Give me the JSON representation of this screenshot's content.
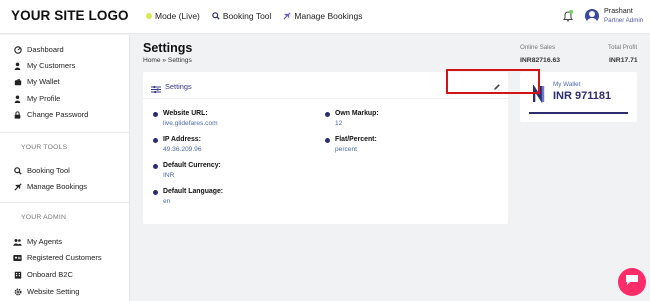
{
  "brand": {
    "logo_text": "YOUR SITE LOGO"
  },
  "topnav": {
    "mode_label": "Mode (Live)",
    "booking_tool_label": "Booking Tool",
    "manage_bookings_label": "Manage Bookings"
  },
  "user": {
    "name": "Prashant",
    "role": "Partner Admin"
  },
  "sidebar": {
    "main_items": [
      {
        "label": "Dashboard",
        "icon": "dashboard-icon"
      },
      {
        "label": "My Customers",
        "icon": "user-icon"
      },
      {
        "label": "My Wallet",
        "icon": "wallet-icon"
      },
      {
        "label": "My Profile",
        "icon": "profile-icon"
      },
      {
        "label": "Change Password",
        "icon": "lock-icon"
      }
    ],
    "tools_heading": "YOUR TOOLS",
    "tools_items": [
      {
        "label": "Booking Tool",
        "icon": "search-icon"
      },
      {
        "label": "Manage Bookings",
        "icon": "plane-icon"
      }
    ],
    "admin_heading": "YOUR ADMIN",
    "admin_items": [
      {
        "label": "My Agents",
        "icon": "users-icon"
      },
      {
        "label": "Registered Customers",
        "icon": "id-card-icon"
      },
      {
        "label": "Onboard B2C",
        "icon": "building-icon"
      },
      {
        "label": "Website Setting",
        "icon": "gear-icon"
      }
    ]
  },
  "page": {
    "title": "Settings",
    "breadcrumb": "Home » Settings"
  },
  "settings_card": {
    "title": "Settings",
    "fields": {
      "website_url": {
        "label": "Website URL:",
        "value": "live.glidefares.com"
      },
      "ip_address": {
        "label": "IP Address:",
        "value": "49.36.209.96"
      },
      "default_currency": {
        "label": "Default Currency:",
        "value": "INR"
      },
      "default_language": {
        "label": "Default Language:",
        "value": "en"
      },
      "own_markup": {
        "label": "Own Markup:",
        "value": "12"
      },
      "flat_percent": {
        "label": "Flat/Percent:",
        "value": "percent"
      }
    }
  },
  "stats": {
    "online_sales_label": "Online Sales",
    "online_sales_value": "INR82716.63",
    "total_profit_label": "Total Profit",
    "total_profit_value": "INR17.71"
  },
  "wallet": {
    "label": "My Wallet",
    "amount": "INR 971181"
  },
  "colors": {
    "accent": "#2c2c6e",
    "link": "#4a6aa8",
    "highlight": "#d21414",
    "chat": "#ff2c6a"
  }
}
